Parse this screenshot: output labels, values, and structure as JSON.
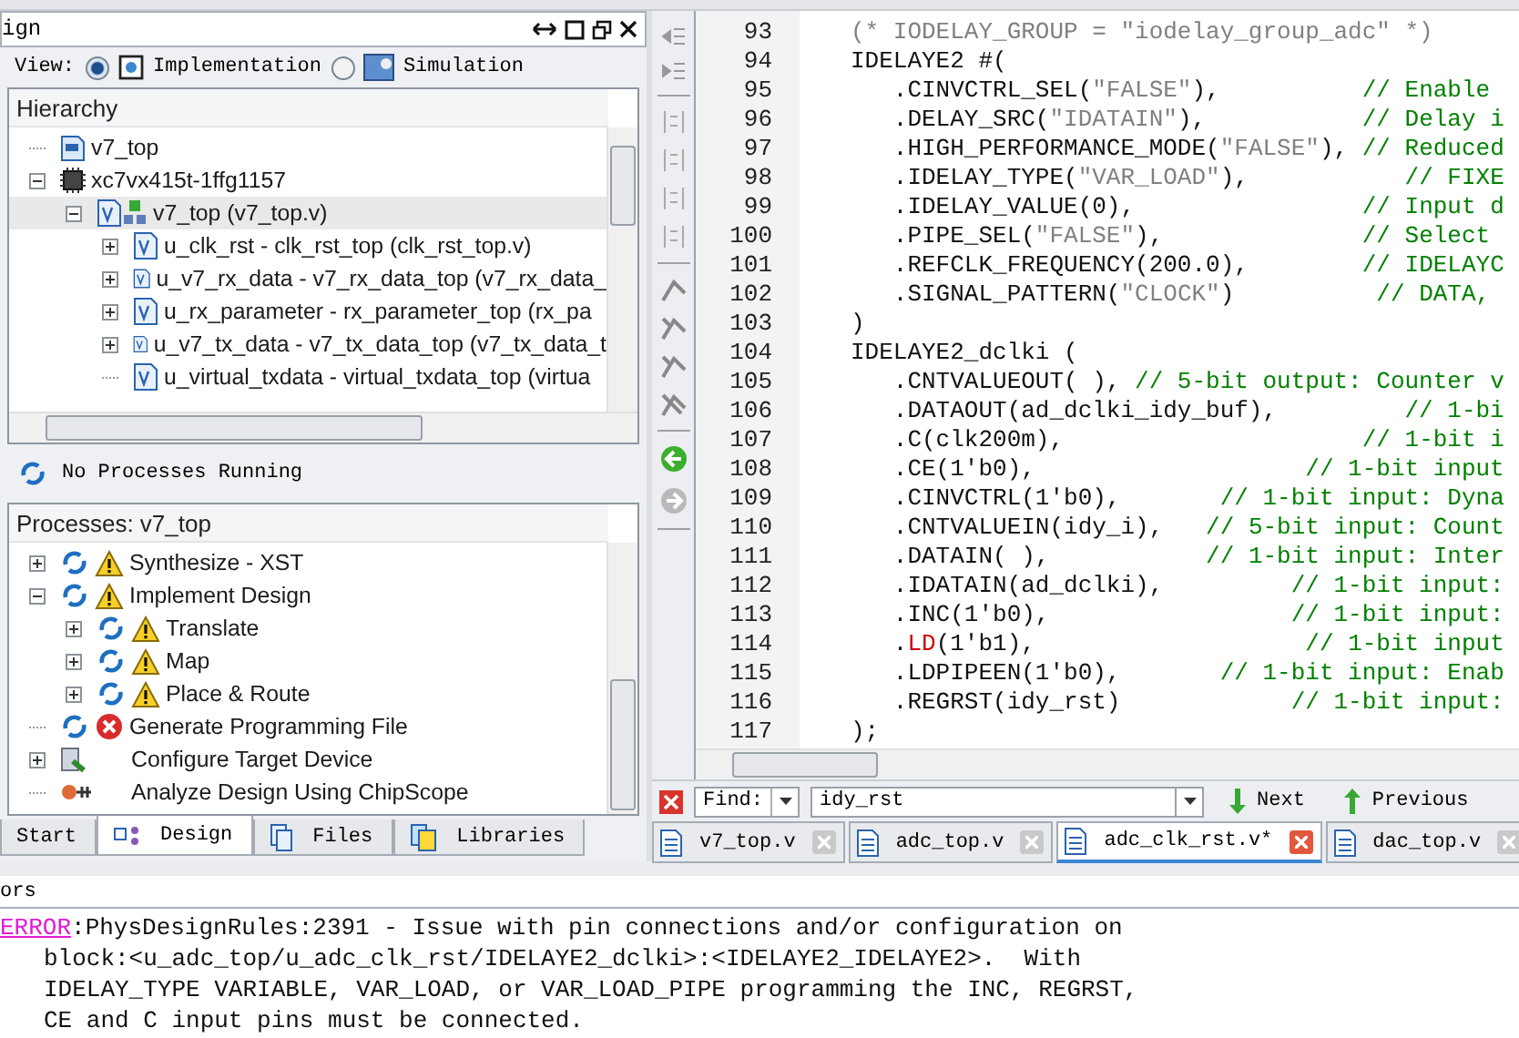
{
  "design_panel": {
    "title": "ign",
    "view_label": "View:",
    "views": [
      {
        "label": "Implementation",
        "selected": true
      },
      {
        "label": "Simulation",
        "selected": false
      }
    ],
    "hierarchy": {
      "title": "Hierarchy",
      "items": [
        {
          "kind": "project",
          "label": "v7_top",
          "selected": false
        },
        {
          "kind": "device",
          "label": "xc7vx415t-1ffg1157",
          "selected": false,
          "expanded": true,
          "children": [
            {
              "kind": "top",
              "label": "v7_top (v7_top.v)",
              "selected": true,
              "expanded": true,
              "children": [
                {
                  "kind": "module",
                  "label": "u_clk_rst - clk_rst_top (clk_rst_top.v)",
                  "selected": false,
                  "expanded": false
                },
                {
                  "kind": "module",
                  "label": "u_v7_rx_data - v7_rx_data_top (v7_rx_data_",
                  "selected": false,
                  "expanded": false
                },
                {
                  "kind": "module",
                  "label": "u_rx_parameter - rx_parameter_top (rx_pa",
                  "selected": false,
                  "expanded": false
                },
                {
                  "kind": "module",
                  "label": "u_v7_tx_data - v7_tx_data_top (v7_tx_data_t",
                  "selected": false,
                  "expanded": false
                },
                {
                  "kind": "module",
                  "label": "u_virtual_txdata - virtual_txdata_top (virtua",
                  "selected": false
                }
              ]
            }
          ]
        }
      ]
    },
    "process_status": "No Processes Running",
    "processes": {
      "title": "Processes: v7_top",
      "items": [
        {
          "kind": "warning",
          "label": "Synthesize - XST",
          "expanded": false
        },
        {
          "kind": "warning",
          "label": "Implement Design",
          "expanded": true,
          "children": [
            {
              "kind": "warning",
              "label": "Translate",
              "expanded": false
            },
            {
              "kind": "warning",
              "label": "Map",
              "expanded": false
            },
            {
              "kind": "warning",
              "label": "Place & Route",
              "expanded": false
            }
          ]
        },
        {
          "kind": "error",
          "label": "Generate Programming File"
        },
        {
          "kind": "device-config",
          "label": "Configure Target Device",
          "expanded": false
        },
        {
          "kind": "chipscope",
          "label": "Analyze Design Using ChipScope"
        }
      ]
    },
    "tabs": [
      {
        "label": "Start",
        "selected": false,
        "kind": "plain"
      },
      {
        "label": "Design",
        "selected": true,
        "kind": "design"
      },
      {
        "label": "Files",
        "selected": false,
        "kind": "files"
      },
      {
        "label": "Libraries",
        "selected": false,
        "kind": "libraries"
      }
    ]
  },
  "editor": {
    "lines": [
      {
        "number": "93",
        "segments": [
          {
            "kind": "attribute",
            "text": "(* IODELAY_GROUP = \"iodelay_group_adc\" *)"
          }
        ]
      },
      {
        "number": "94",
        "segments": [
          {
            "kind": "code",
            "text": "IDELAYE2 #("
          }
        ]
      },
      {
        "number": "95",
        "segments": [
          {
            "kind": "code",
            "text": "   .CINVCTRL_SEL("
          },
          {
            "kind": "string",
            "text": "\"FALSE\""
          },
          {
            "kind": "code",
            "text": "),          "
          },
          {
            "kind": "comment",
            "text": "// Enable"
          }
        ]
      },
      {
        "number": "96",
        "segments": [
          {
            "kind": "code",
            "text": "   .DELAY_SRC("
          },
          {
            "kind": "string",
            "text": "\"IDATAIN\""
          },
          {
            "kind": "code",
            "text": "),           "
          },
          {
            "kind": "comment",
            "text": "// Delay i"
          }
        ]
      },
      {
        "number": "97",
        "segments": [
          {
            "kind": "code",
            "text": "   .HIGH_PERFORMANCE_MODE("
          },
          {
            "kind": "string",
            "text": "\"FALSE\""
          },
          {
            "kind": "code",
            "text": "), "
          },
          {
            "kind": "comment",
            "text": "// Reduced"
          }
        ]
      },
      {
        "number": "98",
        "segments": [
          {
            "kind": "code",
            "text": "   .IDELAY_TYPE("
          },
          {
            "kind": "string",
            "text": "\"VAR_LOAD\""
          },
          {
            "kind": "code",
            "text": "),           "
          },
          {
            "kind": "comment",
            "text": "// FIXE"
          }
        ]
      },
      {
        "number": "99",
        "segments": [
          {
            "kind": "code",
            "text": "   .IDELAY_VALUE(0),                "
          },
          {
            "kind": "comment",
            "text": "// Input d"
          }
        ]
      },
      {
        "number": "100",
        "segments": [
          {
            "kind": "code",
            "text": "   .PIPE_SEL("
          },
          {
            "kind": "string",
            "text": "\"FALSE\""
          },
          {
            "kind": "code",
            "text": "),              "
          },
          {
            "kind": "comment",
            "text": "// Select"
          }
        ]
      },
      {
        "number": "101",
        "segments": [
          {
            "kind": "code",
            "text": "   .REFCLK_FREQUENCY(200.0),        "
          },
          {
            "kind": "comment",
            "text": "// IDELAYC"
          }
        ]
      },
      {
        "number": "102",
        "segments": [
          {
            "kind": "code",
            "text": "   .SIGNAL_PATTERN("
          },
          {
            "kind": "string",
            "text": "\"CLOCK\""
          },
          {
            "kind": "code",
            "text": ")          "
          },
          {
            "kind": "comment",
            "text": "// DATA,"
          }
        ]
      },
      {
        "number": "103",
        "segments": [
          {
            "kind": "code",
            "text": ")"
          }
        ]
      },
      {
        "number": "104",
        "segments": [
          {
            "kind": "code",
            "text": "IDELAYE2_dclki ("
          }
        ]
      },
      {
        "number": "105",
        "segments": [
          {
            "kind": "code",
            "text": "   .CNTVALUEOUT( ), "
          },
          {
            "kind": "comment",
            "text": "// 5-bit output: Counter v"
          }
        ]
      },
      {
        "number": "106",
        "segments": [
          {
            "kind": "code",
            "text": "   .DATAOUT(ad_dclki_idy_buf),         "
          },
          {
            "kind": "comment",
            "text": "// 1-bi"
          }
        ]
      },
      {
        "number": "107",
        "segments": [
          {
            "kind": "code",
            "text": "   .C(clk200m),                     "
          },
          {
            "kind": "comment",
            "text": "// 1-bit i"
          }
        ]
      },
      {
        "number": "108",
        "segments": [
          {
            "kind": "code",
            "text": "   .CE(1'b0),                   "
          },
          {
            "kind": "comment",
            "text": "// 1-bit input"
          }
        ]
      },
      {
        "number": "109",
        "segments": [
          {
            "kind": "code",
            "text": "   .CINVCTRL(1'b0),       "
          },
          {
            "kind": "comment",
            "text": "// 1-bit input: Dyna"
          }
        ]
      },
      {
        "number": "110",
        "segments": [
          {
            "kind": "code",
            "text": "   .CNTVALUEIN(idy_i),   "
          },
          {
            "kind": "comment",
            "text": "// 5-bit input: Count"
          }
        ]
      },
      {
        "number": "111",
        "segments": [
          {
            "kind": "code",
            "text": "   .DATAIN( ),           "
          },
          {
            "kind": "comment",
            "text": "// 1-bit input: Inter"
          }
        ]
      },
      {
        "number": "112",
        "segments": [
          {
            "kind": "code",
            "text": "   .IDATAIN(ad_dclki),         "
          },
          {
            "kind": "comment",
            "text": "// 1-bit input:"
          }
        ]
      },
      {
        "number": "113",
        "segments": [
          {
            "kind": "code",
            "text": "   .INC(1'b0),                 "
          },
          {
            "kind": "comment",
            "text": "// 1-bit input:"
          }
        ]
      },
      {
        "number": "114",
        "segments": [
          {
            "kind": "code",
            "text": "   ."
          },
          {
            "kind": "error",
            "text": "LD"
          },
          {
            "kind": "code",
            "text": "(1'b1),                   "
          },
          {
            "kind": "comment",
            "text": "// 1-bit input"
          }
        ]
      },
      {
        "number": "115",
        "segments": [
          {
            "kind": "code",
            "text": "   .LDPIPEEN(1'b0),       "
          },
          {
            "kind": "comment",
            "text": "// 1-bit input: Enab"
          }
        ]
      },
      {
        "number": "116",
        "segments": [
          {
            "kind": "code",
            "text": "   .REGRST(idy_rst)            "
          },
          {
            "kind": "comment",
            "text": "// 1-bit input:"
          }
        ]
      },
      {
        "number": "117",
        "segments": [
          {
            "kind": "code",
            "text": ");"
          }
        ]
      }
    ]
  },
  "find_bar": {
    "label": "Find:",
    "value": "idy_rst",
    "next": "Next",
    "previous": "Previous"
  },
  "file_tabs": [
    {
      "label": "v7_top.v",
      "selected": false
    },
    {
      "label": "adc_top.v",
      "selected": false
    },
    {
      "label": "adc_clk_rst.v*",
      "selected": true
    },
    {
      "label": "dac_top.v",
      "selected": false
    }
  ],
  "console": {
    "title": "ors",
    "message": {
      "code": "ERROR",
      "text": ":PhysDesignRules:2391 - Issue with pin connections and/or configuration on block:<u_adc_top/u_adc_clk_rst/IDELAYE2_dclki>:<IDELAYE2_IDELAYE2>.  With IDELAY_TYPE VARIABLE, VAR_LOAD, or VAR_LOAD_PIPE programming the INC, REGRST, CE and C input pins must be connected."
    }
  }
}
